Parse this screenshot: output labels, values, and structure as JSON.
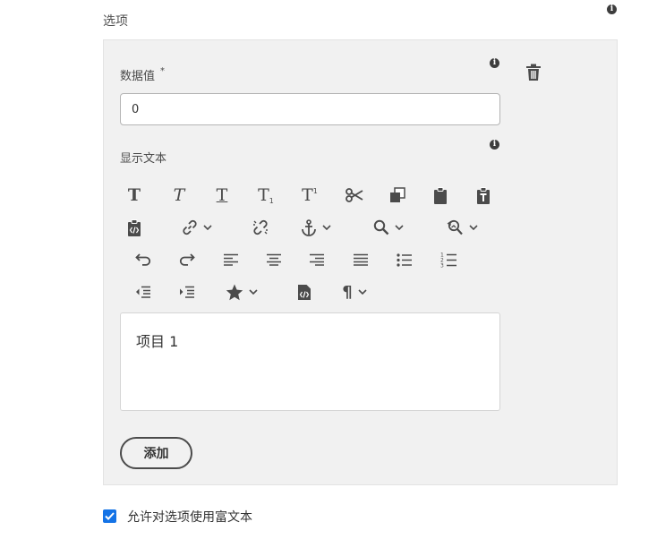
{
  "section_label": "选项",
  "data_value": {
    "label": "数据值",
    "required_mark": "*",
    "value": "0"
  },
  "display_text": {
    "label": "显示文本"
  },
  "editor": {
    "content": "项目 1"
  },
  "toolbar": {
    "row1": [
      {
        "icon": "bold-icon",
        "glyph": "T"
      },
      {
        "icon": "italic-icon",
        "glyph": "T"
      },
      {
        "icon": "underline-icon",
        "glyph": "T"
      },
      {
        "icon": "subscript-icon",
        "glyph": "T"
      },
      {
        "icon": "superscript-icon",
        "glyph": "T"
      },
      {
        "icon": "cut-icon"
      },
      {
        "icon": "copy-icon"
      },
      {
        "icon": "paste-icon"
      },
      {
        "icon": "paste-text-icon"
      }
    ],
    "row2": [
      "paste-html-icon",
      "link-icon",
      "unlink-icon",
      "anchor-icon",
      "find-icon",
      "find-replace-icon"
    ],
    "row3": [
      "undo-icon",
      "redo-icon",
      "align-left-icon",
      "align-center-icon",
      "align-right-icon",
      "justify-icon",
      "bulleted-list-icon",
      "numbered-list-icon"
    ],
    "row4": [
      "outdent-icon",
      "indent-icon",
      "special-char-icon",
      "source-edit-icon",
      "paragraph-format-icon"
    ]
  },
  "add_button": "添加",
  "rich_text_checkbox": {
    "label": "允许对选项使用富文本",
    "checked": true
  },
  "colors": {
    "accent": "#1473e6",
    "panel": "#f1f1f1",
    "icon": "#4b4b4b"
  }
}
